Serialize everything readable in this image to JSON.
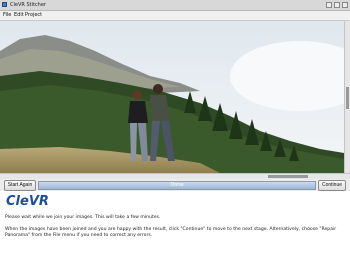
{
  "window": {
    "title": "CleVR Stitcher"
  },
  "menu": {
    "items": [
      "File",
      "Edit",
      "Project"
    ]
  },
  "viewer": {
    "description_icon": "photo-panorama"
  },
  "controls": {
    "start_again_label": "Start Again",
    "progress_label": "Done",
    "progress_fraction": 1.0,
    "continue_label": "Continue"
  },
  "info": {
    "logo": "CleVR",
    "paragraph1": "Please wait while we join your images. This will take a few minutes.",
    "paragraph2": "When the images have been joined and you are happy with the result, click \"Continue\" to move to the next stage. Alternatively, choose \"Repair Panorama\" from the File menu if you need to correct any errors."
  },
  "colors": {
    "accent": "#1a4f99",
    "progress": "#9db7d6"
  }
}
